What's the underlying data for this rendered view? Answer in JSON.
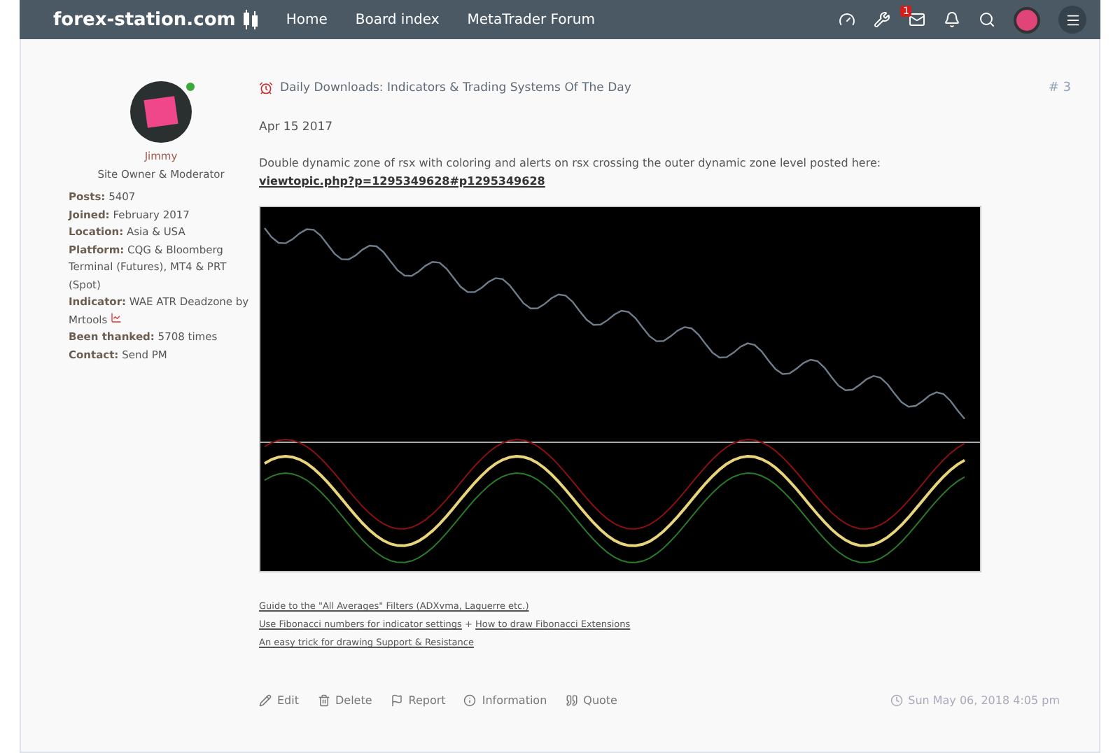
{
  "navbar": {
    "logo": "forex-station.com",
    "links": [
      "Home",
      "Board index",
      "MetaTrader Forum"
    ],
    "mail_badge": "1"
  },
  "author": {
    "name": "Jimmy",
    "rank": "Site Owner & Moderator",
    "online": true,
    "fields": [
      {
        "label": "Posts:",
        "value": "5407"
      },
      {
        "label": "Joined:",
        "value": "February 2017"
      },
      {
        "label": "Location:",
        "value": "Asia & USA"
      },
      {
        "label": "Platform:",
        "value": "CQG & Bloomberg Terminal (Futures), MT4 & PRT (Spot)"
      },
      {
        "label": "Indicator:",
        "value": "WAE ATR Deadzone by Mrtools",
        "kind": "icon"
      },
      {
        "label": "Been thanked:",
        "value": "5708 times"
      },
      {
        "label": "Contact:",
        "value": "Send PM",
        "kind": "link"
      }
    ]
  },
  "post": {
    "title": "Daily Downloads: Indicators & Trading Systems Of The Day",
    "number": "# 3",
    "date": "Apr 15 2017",
    "body": "Double dynamic zone of rsx with coloring and alerts on rsx crossing the outer dynamic zone level posted here:",
    "body_link": "viewtopic.php?p=1295349628#p1295349628",
    "signature_separator": "+",
    "signature": [
      [
        "Guide to the \"All Averages\" Filters (ADXvma, Laguerre etc.)"
      ],
      [
        "Use Fibonacci numbers for indicator settings",
        "How to draw Fibonacci Extensions"
      ],
      [
        "An easy trick for drawing Support & Resistance"
      ]
    ],
    "actions": [
      {
        "kind": "edit",
        "label": "Edit"
      },
      {
        "kind": "delete",
        "label": "Delete"
      },
      {
        "kind": "report",
        "label": "Report"
      },
      {
        "kind": "info",
        "label": "Information"
      },
      {
        "kind": "quote",
        "label": "Quote"
      }
    ],
    "timestamp": "Sun May 06, 2018 4:05 pm"
  }
}
